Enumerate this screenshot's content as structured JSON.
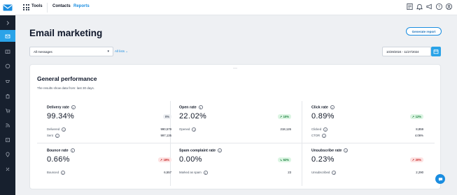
{
  "topbar": {
    "tools_label": "Tools",
    "nav": [
      {
        "label": "Contacts"
      },
      {
        "label": "Reports"
      }
    ],
    "icons": [
      "notes-icon",
      "bell-icon",
      "megaphone-icon",
      "help-icon",
      "account-icon"
    ]
  },
  "sidebar": {
    "items": [
      "expand-chevron-icon",
      "campaigns-icon",
      "automation-icon",
      "chat-icon",
      "transactional-icon",
      "shop-icon",
      "rss-icon",
      "crm-icon",
      "location-icon",
      "integrations-icon"
    ]
  },
  "page": {
    "title": "Email marketing",
    "generate_report": "Generate report"
  },
  "filters": {
    "messages_value": "All messages",
    "lists_label": "All lists",
    "date_range": "10/29/2024 - 11/27/2024"
  },
  "card": {
    "title": "General performance",
    "subtitle": "The results show data from: last 30 days.",
    "metrics": [
      {
        "label": "Delivery rate",
        "value": "99.34%",
        "badge": "0%",
        "trend": "neutral",
        "rows": [
          {
            "label": "Delivered",
            "value": "990,579"
          },
          {
            "label": "Sent",
            "value": "997,135"
          }
        ]
      },
      {
        "label": "Open rate",
        "value": "22.02%",
        "badge": "10%",
        "trend": "up",
        "rows": [
          {
            "label": "Opened",
            "value": "218,126"
          }
        ]
      },
      {
        "label": "Click rate",
        "value": "0.89%",
        "badge": "12%",
        "trend": "up",
        "rows": [
          {
            "label": "Clicked",
            "value": "8,859"
          },
          {
            "label": "CTOR",
            "value": "4.06%"
          }
        ]
      },
      {
        "label": "Bounce rate",
        "value": "0.66%",
        "badge": "18%",
        "trend": "down",
        "rows": [
          {
            "label": "Bounced",
            "value": "6,557"
          }
        ]
      },
      {
        "label": "Spam complaint rate",
        "value": "0.00%",
        "badge": "62%",
        "trend": "up",
        "rows": [
          {
            "label": "Marked as spam",
            "value": "23"
          }
        ]
      },
      {
        "label": "Unsubscribe rate",
        "value": "0.23%",
        "badge": "20%",
        "trend": "down",
        "rows": [
          {
            "label": "Unsubscribed",
            "value": "2,290"
          }
        ]
      }
    ]
  },
  "colors": {
    "accent": "#1a8de0",
    "sidebar_bg": "#17202e",
    "sidebar_active": "#2aa3e8",
    "up": "#1a7f3c",
    "down": "#c62828"
  }
}
